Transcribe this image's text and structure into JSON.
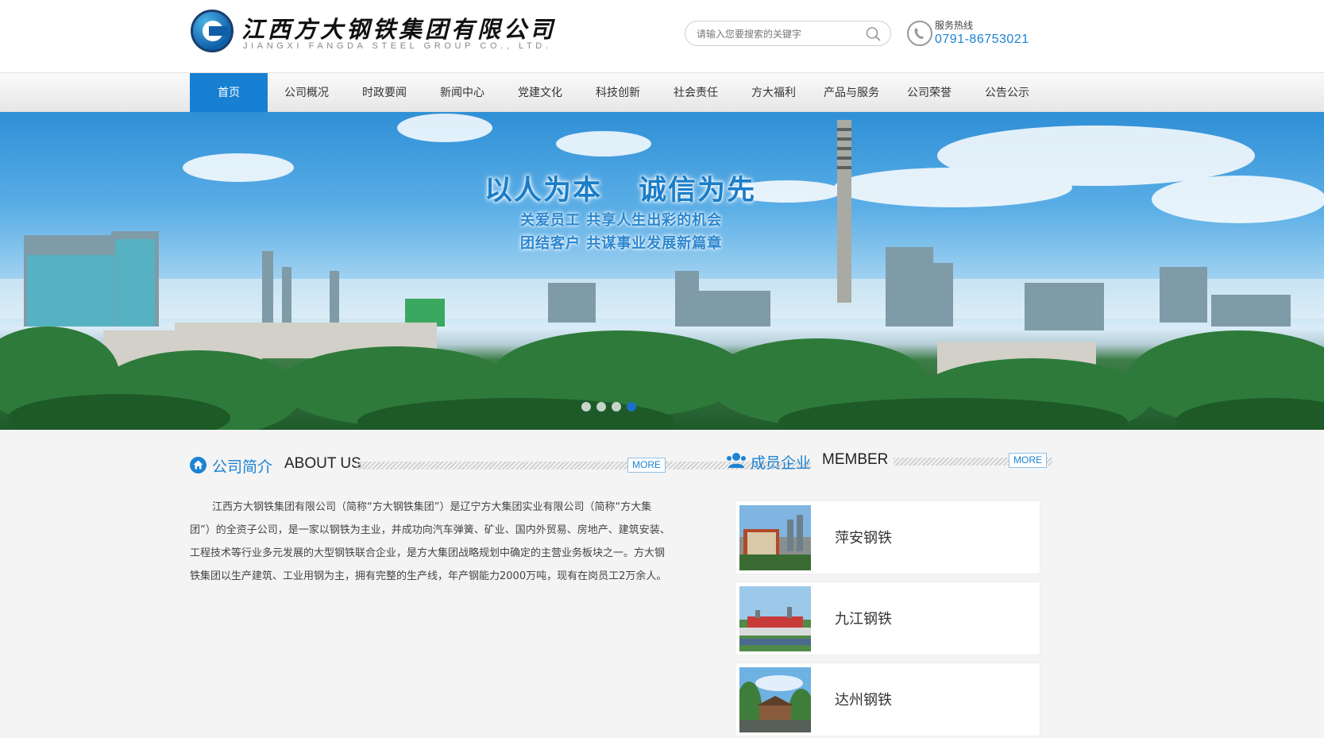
{
  "header": {
    "logo_cn": "江西方大钢铁集团有限公司",
    "logo_en": "JIANGXI FANGDA STEEL GROUP CO., LTD.",
    "search_placeholder": "请输入您要搜索的关键字",
    "hotline_label": "服务热线",
    "hotline_number": "0791-86753021"
  },
  "nav": {
    "items": [
      {
        "label": "首页",
        "active": true
      },
      {
        "label": "公司概况"
      },
      {
        "label": "时政要闻"
      },
      {
        "label": "新闻中心"
      },
      {
        "label": "党建文化"
      },
      {
        "label": "科技创新"
      },
      {
        "label": "社会责任"
      },
      {
        "label": "方大福利"
      },
      {
        "label": "产品与服务"
      },
      {
        "label": "公司荣誉"
      },
      {
        "label": "公告公示"
      }
    ]
  },
  "banner": {
    "slogan_left": "以人为本",
    "slogan_right": "诚信为先",
    "sub_line1": "关爱员工 共享人生出彩的机会",
    "sub_line2": "团结客户 共谋事业发展新篇章",
    "slide_count": 4,
    "active_slide": 4
  },
  "about": {
    "title_cn": "公司简介",
    "title_en": "ABOUT US",
    "more": "MORE",
    "text": "江西方大钢铁集团有限公司（简称“方大钢铁集团”）是辽宁方大集团实业有限公司（简称“方大集团”）的全资子公司，是一家以钢铁为主业，并成功向汽车弹簧、矿业、国内外贸易、房地产、建筑安装、工程技术等行业多元发展的大型钢铁联合企业，是方大集团战略规划中确定的主营业务板块之一。方大钢铁集团以生产建筑、工业用钢为主，拥有完整的生产线，年产钢能力2000万吨，现有在岗员工2万余人。"
  },
  "member": {
    "title_cn": "成员企业",
    "title_en": "MEMBER",
    "more": "MORE",
    "items": [
      {
        "name": "萍安钢铁"
      },
      {
        "name": "九江钢铁"
      },
      {
        "name": "达州钢铁"
      }
    ]
  },
  "colors": {
    "accent": "#1780d2",
    "text": "#333333",
    "page_bg": "#f4f4f4"
  }
}
